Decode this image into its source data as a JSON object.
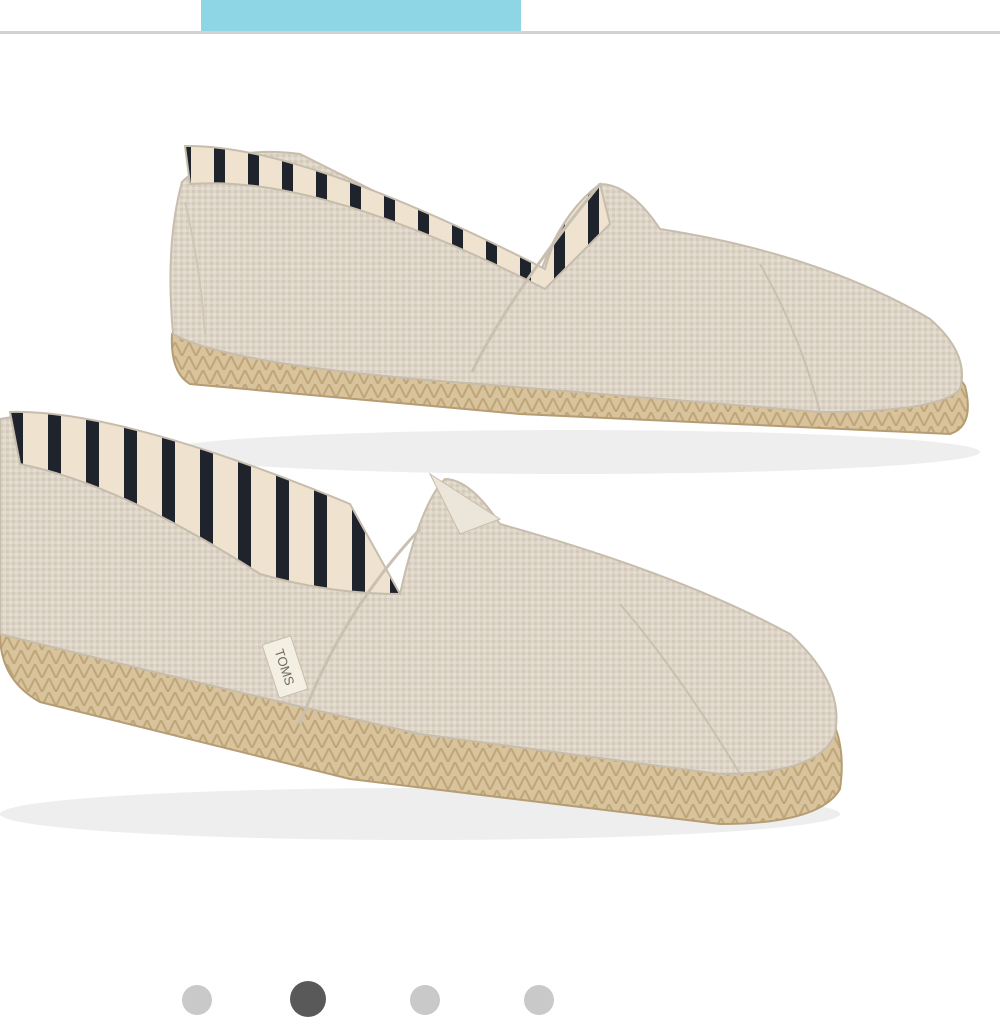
{
  "product": {
    "brand_tag": "TOMS",
    "image_subject": "shoe-pair-photo"
  },
  "carousel": {
    "total": 4,
    "active_index": 1
  },
  "colors": {
    "tab_accent": "#8ed6e6",
    "dot_active": "#595959",
    "dot_inactive": "#c9c9c9",
    "canvas": "#f2ede6",
    "jute": "#d8c39d",
    "stripe": "#1f232b"
  },
  "icons": {
    "dots": "carousel-dot-icon"
  }
}
